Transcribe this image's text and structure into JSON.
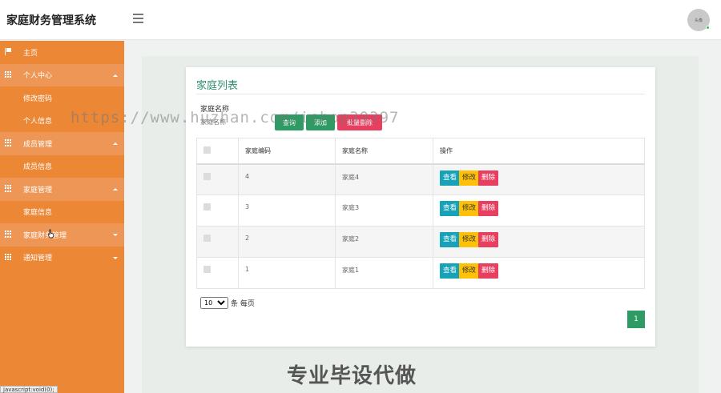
{
  "app": {
    "title": "家庭财务管理系统",
    "avatar_label": "头像"
  },
  "sidebar": {
    "items": [
      {
        "label": "主页",
        "icon": "flag-icon",
        "type": "link"
      },
      {
        "label": "个人中心",
        "icon": "grid-icon",
        "type": "group",
        "expanded": true
      },
      {
        "label": "修改密码",
        "type": "sub"
      },
      {
        "label": "个人信息",
        "type": "sub"
      },
      {
        "label": "成员管理",
        "icon": "grid-icon",
        "type": "group",
        "expanded": true
      },
      {
        "label": "成员信息",
        "type": "sub"
      },
      {
        "label": "家庭管理",
        "icon": "grid-icon",
        "type": "group",
        "expanded": true
      },
      {
        "label": "家庭信息",
        "type": "sub"
      },
      {
        "label": "家庭财务管理",
        "icon": "grid-icon",
        "type": "group",
        "expanded": false
      },
      {
        "label": "通知管理",
        "icon": "grid-icon",
        "type": "group",
        "expanded": false
      }
    ]
  },
  "main": {
    "title": "家庭列表",
    "search": {
      "label": "家庭名称",
      "placeholder": "家庭名称"
    },
    "buttons": {
      "search": "查询",
      "add": "添加",
      "batch_delete": "批量删除"
    },
    "table": {
      "columns": [
        "家庭编码",
        "家庭名称",
        "操作"
      ],
      "rows": [
        {
          "code": "4",
          "name": "家庭4"
        },
        {
          "code": "3",
          "name": "家庭3"
        },
        {
          "code": "2",
          "name": "家庭2"
        },
        {
          "code": "1",
          "name": "家庭1"
        }
      ],
      "actions": {
        "view": "查看",
        "edit": "修改",
        "delete": "删除"
      }
    },
    "pagination": {
      "page_size": "10",
      "per_page_label": "条 每页",
      "current_page": "1"
    }
  },
  "overlay": {
    "watermark": "https://www.huzhan.com/ishop39397",
    "promo": "专业毕设代做",
    "status_url": "javascript:void(0);"
  },
  "colors": {
    "sidebar": "#ec8736",
    "accent": "#2f8f6f",
    "view": "#17a2b8",
    "edit": "#ffc107",
    "delete": "#e83e5f"
  }
}
